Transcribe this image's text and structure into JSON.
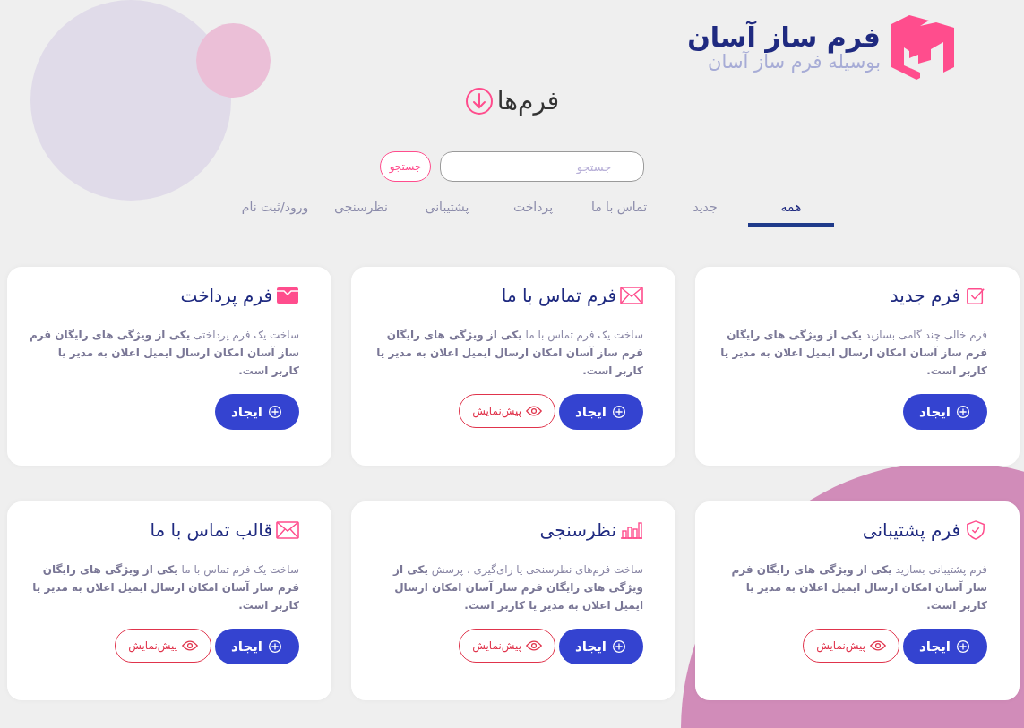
{
  "brand": {
    "title": "فرم ساز آسان",
    "subtitle": "بوسیله فرم ساز آسان"
  },
  "heading": "فرم‌ها",
  "search": {
    "placeholder": "جستجو",
    "button": "جستجو"
  },
  "tabs": [
    {
      "label": "همه",
      "selected": true
    },
    {
      "label": "جدید",
      "selected": false
    },
    {
      "label": "تماس با ما",
      "selected": false
    },
    {
      "label": "پرداخت",
      "selected": false
    },
    {
      "label": "پشتیبانی",
      "selected": false
    },
    {
      "label": "نظرسنجی",
      "selected": false
    },
    {
      "label": "ورود/ثبت نام",
      "selected": false
    }
  ],
  "cards": [
    {
      "kind": "check",
      "title": "فرم جدید",
      "description": "فرم خالی چند گامی بسازید **یکی از ویژگی های رایگان فرم ساز آسان امکان ارسال ایمیل اعلان به مدیر یا کاربر است.**",
      "create": "ایجاد"
    },
    {
      "kind": "mail",
      "title": "فرم تماس با ما",
      "description": "ساخت یک فرم تماس با ما **یکی از ویژگی های رایگان فرم ساز آسان امکان ارسال ایمیل اعلان به مدیر یا کاربر است.**",
      "create": "ایجاد",
      "preview": "پیش‌نمایش"
    },
    {
      "kind": "wallet",
      "title": "فرم پرداخت",
      "description": "ساخت یک فرم پرداختی **یکی از ویژگی های رایگان فرم ساز آسان امکان ارسال ایمیل اعلان به مدیر یا کاربر است.**",
      "create": "ایجاد"
    },
    {
      "kind": "shield",
      "title": "فرم پشتیبانی",
      "description": "فرم پشتیبانی بسازید **یکی از ویژگی های رایگان فرم ساز آسان امکان ارسال ایمیل اعلان به مدیر یا کاربر است.**",
      "create": "ایجاد",
      "preview": "پیش‌نمایش"
    },
    {
      "kind": "chart",
      "title": "نظرسنجی",
      "description": "ساخت فرم‌های نظرسنجی یا رای‌گیری ، پرسش **یکی از ویژگی های رایگان فرم ساز آسان امکان ارسال ایمیل اعلان به مدیر یا کاربر است.**",
      "create": "ایجاد",
      "preview": "پیش‌نمایش"
    },
    {
      "kind": "mail",
      "title": "قالب تماس با ما",
      "description": "ساخت یک فرم تماس با ما **یکی از ویژگی های رایگان فرم ساز آسان امکان ارسال ایمیل اعلان به مدیر یا کاربر است.**",
      "create": "ایجاد",
      "preview": "پیش‌نمایش"
    }
  ]
}
